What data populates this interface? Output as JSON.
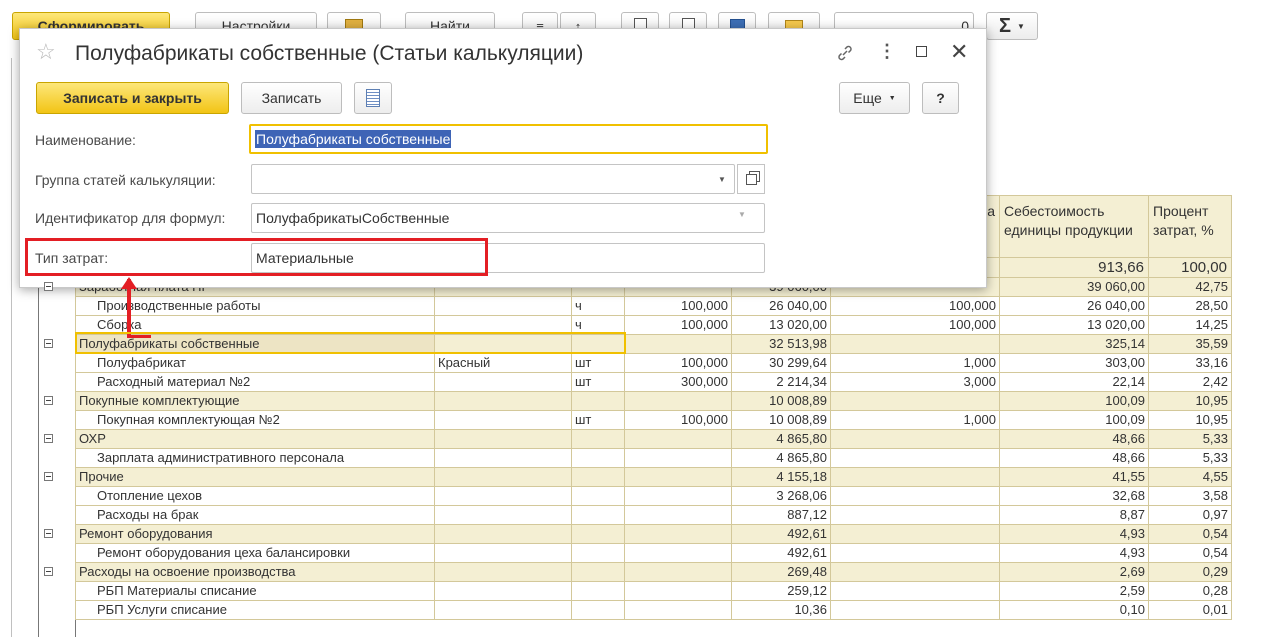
{
  "toolbar": {
    "generate_label": "Сформировать",
    "settings_label": "Настройки",
    "find_label": "Найти",
    "search_value": "0",
    "sum_label": "Σ"
  },
  "dialog": {
    "title": "Полуфабрикаты собственные (Статьи калькуляции)",
    "save_close_label": "Записать и закрыть",
    "save_label": "Записать",
    "more_label": "Еще",
    "help_label": "?",
    "fields": {
      "name_label": "Наименование:",
      "name_value": "Полуфабрикаты собственные",
      "group_label": "Группа статей калькуляции:",
      "group_value": "",
      "formula_label": "Идентификатор для формул:",
      "formula_value": "ПолуфабрикатыСобственные",
      "cost_type_label": "Тип затрат:",
      "cost_type_value": "Материальные"
    }
  },
  "report": {
    "header": {
      "col_partial": "а",
      "unit_cost": "Себестоимость единицы продукции",
      "percent": "Процент затрат, %"
    },
    "totals": {
      "unit_cost": "913,66",
      "percent": "100,00"
    },
    "rows": [
      {
        "type": "group",
        "name": "Заработная плата ПР",
        "char": "",
        "unit": "",
        "qty": "",
        "sum": "39 060,00",
        "norm": "",
        "unit_cost": "39 060,00",
        "percent": "42,75"
      },
      {
        "type": "item",
        "name": "Производственные работы",
        "char": "",
        "unit": "ч",
        "qty": "100,000",
        "sum": "26 040,00",
        "norm": "100,000",
        "unit_cost": "26 040,00",
        "percent": "28,50"
      },
      {
        "type": "item",
        "name": "Сборка",
        "char": "",
        "unit": "ч",
        "qty": "100,000",
        "sum": "13 020,00",
        "norm": "100,000",
        "unit_cost": "13 020,00",
        "percent": "14,25"
      },
      {
        "type": "group",
        "name": "Полуфабрикаты собственные",
        "char": "",
        "unit": "",
        "qty": "",
        "sum": "32 513,98",
        "norm": "",
        "unit_cost": "325,14",
        "percent": "35,59",
        "hl": true
      },
      {
        "type": "item",
        "name": "Полуфабрикат",
        "char": "Красный",
        "unit": "шт",
        "qty": "100,000",
        "sum": "30 299,64",
        "norm": "1,000",
        "unit_cost": "303,00",
        "percent": "33,16"
      },
      {
        "type": "item",
        "name": "Расходный материал №2",
        "char": "",
        "unit": "шт",
        "qty": "300,000",
        "sum": "2 214,34",
        "norm": "3,000",
        "unit_cost": "22,14",
        "percent": "2,42"
      },
      {
        "type": "group",
        "name": "Покупные комплектующие",
        "char": "",
        "unit": "",
        "qty": "",
        "sum": "10 008,89",
        "norm": "",
        "unit_cost": "100,09",
        "percent": "10,95"
      },
      {
        "type": "item",
        "name": "Покупная комплектующая №2",
        "char": "",
        "unit": "шт",
        "qty": "100,000",
        "sum": "10 008,89",
        "norm": "1,000",
        "unit_cost": "100,09",
        "percent": "10,95"
      },
      {
        "type": "group",
        "name": "ОХР",
        "char": "",
        "unit": "",
        "qty": "",
        "sum": "4 865,80",
        "norm": "",
        "unit_cost": "48,66",
        "percent": "5,33"
      },
      {
        "type": "item",
        "name": "Зарплата административного персонала",
        "char": "",
        "unit": "",
        "qty": "",
        "sum": "4 865,80",
        "norm": "",
        "unit_cost": "48,66",
        "percent": "5,33"
      },
      {
        "type": "group",
        "name": "Прочие",
        "char": "",
        "unit": "",
        "qty": "",
        "sum": "4 155,18",
        "norm": "",
        "unit_cost": "41,55",
        "percent": "4,55"
      },
      {
        "type": "item",
        "name": "Отопление цехов",
        "char": "",
        "unit": "",
        "qty": "",
        "sum": "3 268,06",
        "norm": "",
        "unit_cost": "32,68",
        "percent": "3,58"
      },
      {
        "type": "item",
        "name": "Расходы на брак",
        "char": "",
        "unit": "",
        "qty": "",
        "sum": "887,12",
        "norm": "",
        "unit_cost": "8,87",
        "percent": "0,97"
      },
      {
        "type": "group",
        "name": "Ремонт оборудования",
        "char": "",
        "unit": "",
        "qty": "",
        "sum": "492,61",
        "norm": "",
        "unit_cost": "4,93",
        "percent": "0,54"
      },
      {
        "type": "item",
        "name": "Ремонт оборудования цеха балансировки",
        "char": "",
        "unit": "",
        "qty": "",
        "sum": "492,61",
        "norm": "",
        "unit_cost": "4,93",
        "percent": "0,54"
      },
      {
        "type": "group",
        "name": "Расходы на освоение производства",
        "char": "",
        "unit": "",
        "qty": "",
        "sum": "269,48",
        "norm": "",
        "unit_cost": "2,69",
        "percent": "0,29"
      },
      {
        "type": "item",
        "name": "РБП Материалы списание",
        "char": "",
        "unit": "",
        "qty": "",
        "sum": "259,12",
        "norm": "",
        "unit_cost": "2,59",
        "percent": "0,28"
      },
      {
        "type": "item",
        "name": "РБП Услуги списание",
        "char": "",
        "unit": "",
        "qty": "",
        "sum": "10,36",
        "norm": "",
        "unit_cost": "0,10",
        "percent": "0,01"
      }
    ]
  },
  "colors": {
    "primary_button": "#f2c415",
    "group_row": "#f4efd3",
    "highlight_border": "#e31e24",
    "selection": "#3e64b6",
    "focus_border": "#f0c000"
  }
}
